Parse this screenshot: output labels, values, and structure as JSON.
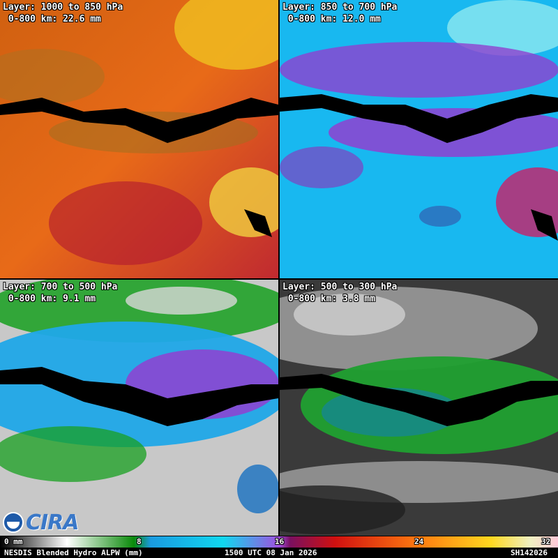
{
  "panels": [
    {
      "layer": "Layer: 1000 to 850 hPa",
      "value": " 0-800 km: 22.6 mm"
    },
    {
      "layer": "Layer: 850 to 700 hPa",
      "value": " 0-800 km: 12.0 mm"
    },
    {
      "layer": "Layer: 700 to 500 hPa",
      "value": " 0-800 km: 9.1 mm"
    },
    {
      "layer": "Layer: 500 to 300 hPa",
      "value": " 0-800 km: 3.8 mm"
    }
  ],
  "colorbar": {
    "ticks": [
      "0 mm",
      "8",
      "16",
      "24",
      "32"
    ]
  },
  "footer": {
    "product": "NESDIS Blended Hydro ALPW (mm)",
    "time": "1500 UTC 08 Jan 2026",
    "id": "SH142026"
  },
  "logo": {
    "text": "CIRA"
  },
  "colors": {
    "panel1": [
      "#c01830",
      "#e05010",
      "#f08020",
      "#ffd020"
    ],
    "panel2": [
      "#18c8f0",
      "#8040d0",
      "#a030b0",
      "#3050c0"
    ],
    "panel3": [
      "#10a020",
      "#20b0e8",
      "#9040d0",
      "#c0c0c0"
    ],
    "panel4": [
      "#303030",
      "#909090",
      "#c8c8c8",
      "#20a030"
    ]
  }
}
